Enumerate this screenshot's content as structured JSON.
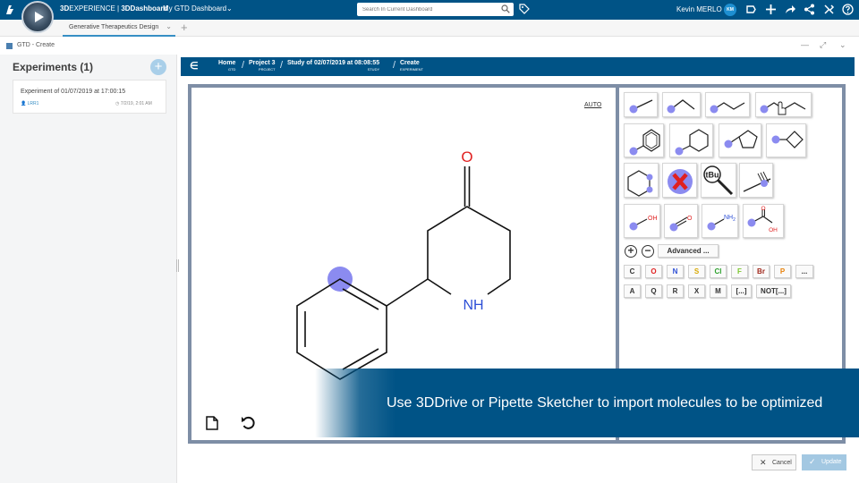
{
  "topbar": {
    "brand_bold": "3D",
    "brand_rest": "EXPERIENCE | ",
    "app": "3DDashboard",
    "dashboard_name": "My GTD Dashboard",
    "search_placeholder": "Search In Current Dashboard",
    "user_name": "Kevin MERLO",
    "user_initials": "KM",
    "icons": [
      "share-icon",
      "add-icon",
      "forward-icon",
      "network-icon",
      "tools-icon",
      "help-icon"
    ]
  },
  "tabs": [
    {
      "label": "Generative Therapeutics Design"
    }
  ],
  "widget": {
    "title": "GTD - Create"
  },
  "experiments": {
    "heading": "Experiments (1)",
    "items": [
      {
        "name": "Experiment of 01/07/2019 at 17:00:15",
        "user": "LRR1",
        "date": "7/2/19, 2:01 AM"
      }
    ]
  },
  "breadcrumb": [
    {
      "label": "Home",
      "sub": "GTD"
    },
    {
      "label": "Project 3",
      "sub": "PROJECT"
    },
    {
      "label": "Study of 02/07/2019 at 08:08:55",
      "sub": "STUDY"
    },
    {
      "label": "Create",
      "sub": "EXPERIMENT"
    }
  ],
  "sketcher": {
    "auto_label": "AUTO",
    "atoms": {
      "oxygen": "O",
      "nitrogen": "NH"
    },
    "palette": {
      "tbu": "tBu",
      "oh": "OH",
      "o": "O",
      "nh2": "NH",
      "nh2_sub": "2",
      "acid_o": "O",
      "acid_oh": "OH",
      "advanced": "Advanced ...",
      "elements": [
        {
          "symbol": "C",
          "color": "#333333"
        },
        {
          "symbol": "O",
          "color": "#e02020"
        },
        {
          "symbol": "N",
          "color": "#2d4fd6"
        },
        {
          "symbol": "S",
          "color": "#d8a800"
        },
        {
          "symbol": "Cl",
          "color": "#2ca02c"
        },
        {
          "symbol": "F",
          "color": "#7ac62c"
        },
        {
          "symbol": "Br",
          "color": "#a0261a"
        },
        {
          "symbol": "P",
          "color": "#e8820c"
        },
        {
          "symbol": "...",
          "color": "#333333"
        }
      ],
      "queries": [
        "A",
        "Q",
        "R",
        "X",
        "M",
        "[...]",
        "NOT[...]"
      ]
    }
  },
  "banner": {
    "text": "Use 3DDrive or Pipette Sketcher to import molecules to be optimized"
  },
  "actions": {
    "cancel": "Cancel",
    "update": "Update"
  },
  "colors": {
    "brand": "#005386",
    "accent": "#368ec4",
    "highlight": "#8b8bf0"
  }
}
